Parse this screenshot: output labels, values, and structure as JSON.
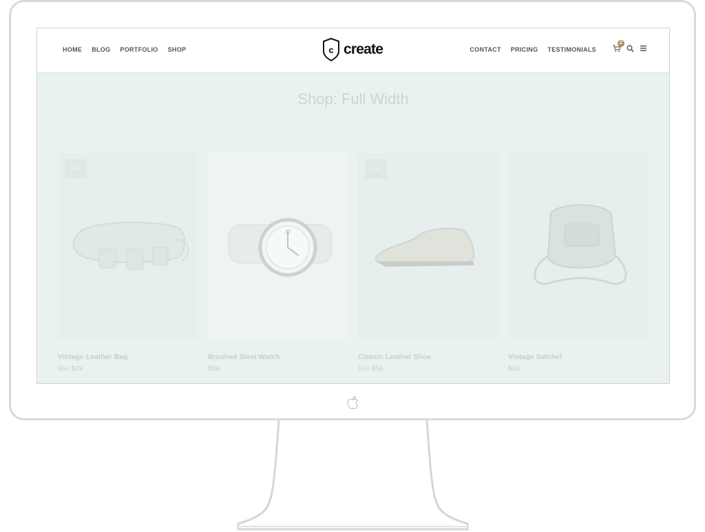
{
  "nav_left": [
    "HOME",
    "BLOG",
    "PORTFOLIO",
    "SHOP"
  ],
  "nav_right": [
    "CONTACT",
    "PRICING",
    "TESTIMONIALS"
  ],
  "logo": {
    "letter": "c",
    "text": "create"
  },
  "cart": {
    "count": "2"
  },
  "page_title": "Shop: Full Width",
  "products": [
    {
      "name": "Vintage Leather Bag",
      "old_price": "$59",
      "price": "$49",
      "sale_label": "Sale"
    },
    {
      "name": "Brushed Steel Watch",
      "old_price": "",
      "price": "$99",
      "sale_label": ""
    },
    {
      "name": "Classic Leather Shoe",
      "old_price": "$79",
      "price": "$59",
      "sale_label": "Sale"
    },
    {
      "name": "Vintage Satchel",
      "old_price": "",
      "price": "$39",
      "sale_label": ""
    }
  ],
  "colors": {
    "accent": "#b28b55",
    "screen_bg": "#eaf2f0",
    "frame": "#d9d9d9"
  },
  "icons": [
    "cart-icon",
    "search-icon",
    "menu-icon",
    "apple-logo-icon"
  ]
}
